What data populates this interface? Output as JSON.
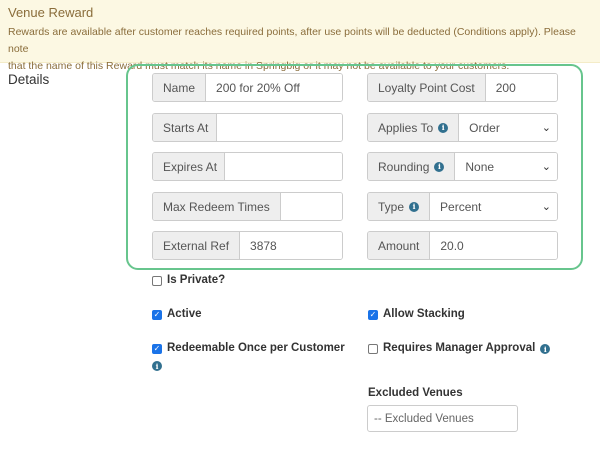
{
  "banner": {
    "title": "Venue Reward",
    "line1": "Rewards are available after customer reaches required points, after use points will be deducted (Conditions apply). Please note",
    "line2": "that the name of this Reward must match its name in Springbig or it may not be available to your customers."
  },
  "section_label": "Details",
  "fields": {
    "name": {
      "label": "Name",
      "value": "200 for 20% Off"
    },
    "loyalty_point_cost": {
      "label": "Loyalty Point Cost",
      "value": "200"
    },
    "starts_at": {
      "label": "Starts At",
      "value": ""
    },
    "applies_to": {
      "label": "Applies To",
      "value": "Order"
    },
    "expires_at": {
      "label": "Expires At",
      "value": ""
    },
    "rounding": {
      "label": "Rounding",
      "value": "None"
    },
    "max_redeem_times": {
      "label": "Max Redeem Times",
      "value": ""
    },
    "type": {
      "label": "Type",
      "value": "Percent"
    },
    "external_ref": {
      "label": "External Ref",
      "value": "3878"
    },
    "amount": {
      "label": "Amount",
      "value": "20.0"
    }
  },
  "checkboxes": {
    "is_private": {
      "label": "Is Private?",
      "checked": false
    },
    "active": {
      "label": "Active",
      "checked": true
    },
    "allow_stacking": {
      "label": "Allow Stacking",
      "checked": true
    },
    "redeemable_once": {
      "label": "Redeemable Once per Customer",
      "checked": true
    },
    "requires_manager_approval": {
      "label": "Requires Manager Approval",
      "checked": false
    }
  },
  "excluded_venues": {
    "label": "Excluded Venues",
    "placeholder": "-- Excluded Venues"
  },
  "icons": {
    "info": "info-icon",
    "dropdown": "chevron-down-icon",
    "checkmark": "check-icon"
  },
  "colors": {
    "banner_bg": "#fcf8e3",
    "banner_text": "#8a6d3b",
    "highlight_border": "#67c58d",
    "checkbox_checked": "#1a73e8",
    "info_icon": "#31708f"
  }
}
